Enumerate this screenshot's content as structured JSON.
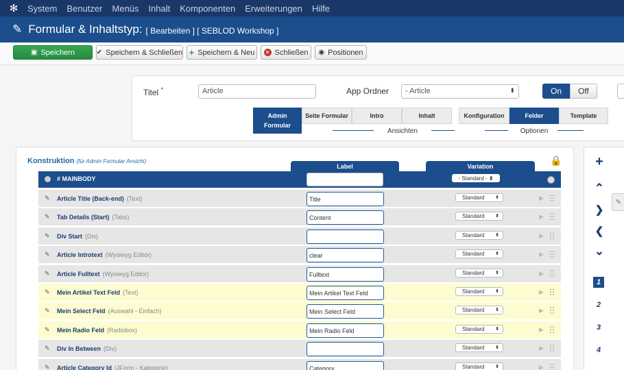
{
  "topnav": {
    "logo_icon": "joomla-logo-icon",
    "items": [
      "System",
      "Benutzer",
      "Menüs",
      "Inhalt",
      "Komponenten",
      "Erweiterungen",
      "Hilfe"
    ]
  },
  "header": {
    "title": "Formular & Inhaltstyp:",
    "subtitle": "[ Bearbeiten ] [ SEBLOD Workshop ]"
  },
  "toolbar": {
    "save": "Speichern",
    "save_close": "Speichern & Schließen",
    "save_new": "Speichern & Neu",
    "close": "Schließen",
    "positions": "Positionen"
  },
  "form": {
    "title_label": "Titel",
    "title_required": "*",
    "title_value": "Article",
    "folder_label": "App Ordner",
    "folder_value": "- Article",
    "toggle_on": "On",
    "toggle_off": "Off",
    "views_tabs": [
      "Admin Formular",
      "Seite Formular",
      "Intro",
      "Inhalt"
    ],
    "views_caption": "Ansichten",
    "options_tabs": [
      "Konfiguration",
      "Felder",
      "Template"
    ],
    "options_caption": "Optionen"
  },
  "main": {
    "title": "Konstruktion",
    "title_note": "(für Admin Formular Ansicht)",
    "col_label": "Label",
    "col_variation": "Variation",
    "mainbody": "# MAINBODY",
    "mainbody_variation": "- Standard -",
    "rows": [
      {
        "name": "Article Title (Back-end)",
        "type": "(Text)",
        "label": "Title",
        "variation": "Standard",
        "highlight": false
      },
      {
        "name": "Tab Details (Start)",
        "type": "(Tabs)",
        "label": "Content",
        "variation": "Standard",
        "highlight": false
      },
      {
        "name": "Div Start",
        "type": "(Div)",
        "label": "",
        "variation": "Standard",
        "highlight": false
      },
      {
        "name": "Article Introtext",
        "type": "(Wysiwyg Editor)",
        "label": "clear",
        "variation": "Standard",
        "highlight": false
      },
      {
        "name": "Article Fulltext",
        "type": "(Wysiwyg Editor)",
        "label": "Fulltext",
        "variation": "Standard",
        "highlight": false
      },
      {
        "name": "Mein Artikel Text Feld",
        "type": "(Text)",
        "label": "Mein Artikel Text Feld",
        "variation": "Standard",
        "highlight": true
      },
      {
        "name": "Mein Select Feld",
        "type": "(Auswahl - Einfach)",
        "label": "Mein Select Feld",
        "variation": "Standard",
        "highlight": true
      },
      {
        "name": "Mein Radio Feld",
        "type": "(Radiobox)",
        "label": "Mein Radio Feld",
        "variation": "Standard",
        "highlight": true
      },
      {
        "name": "Div In Between",
        "type": "(Div)",
        "label": "",
        "variation": "Standard",
        "highlight": false
      },
      {
        "name": "Article Category Id",
        "type": "(JForm - Kategorie)",
        "label": "Category",
        "variation": "Standard",
        "highlight": false
      }
    ]
  },
  "sidebar": {
    "numbers": [
      "1",
      "2",
      "3",
      "4"
    ]
  }
}
